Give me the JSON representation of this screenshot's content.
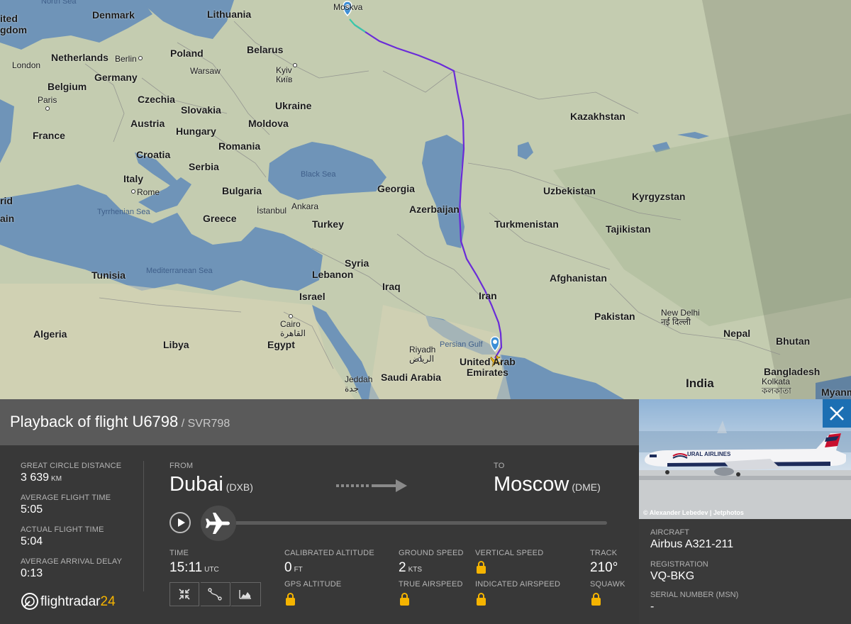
{
  "map": {
    "countries": [
      {
        "id": "c-united-kingdom",
        "label": "ited\ngdom"
      },
      {
        "id": "c-denmark",
        "label": "Denmark"
      },
      {
        "id": "c-lithuania",
        "label": "Lithuania"
      },
      {
        "id": "c-netherlands",
        "label": "Netherlands"
      },
      {
        "id": "c-poland",
        "label": "Poland"
      },
      {
        "id": "c-belarus",
        "label": "Belarus"
      },
      {
        "id": "c-germany",
        "label": "Germany"
      },
      {
        "id": "c-belgium",
        "label": "Belgium"
      },
      {
        "id": "c-czechia",
        "label": "Czechia"
      },
      {
        "id": "c-slovakia",
        "label": "Slovakia"
      },
      {
        "id": "c-ukraine",
        "label": "Ukraine"
      },
      {
        "id": "c-kazakhstan",
        "label": "Kazakhstan"
      },
      {
        "id": "c-austria",
        "label": "Austria"
      },
      {
        "id": "c-moldova",
        "label": "Moldova"
      },
      {
        "id": "c-hungary",
        "label": "Hungary"
      },
      {
        "id": "c-france",
        "label": "France"
      },
      {
        "id": "c-romania",
        "label": "Romania"
      },
      {
        "id": "c-croatia",
        "label": "Croatia"
      },
      {
        "id": "c-serbia",
        "label": "Serbia"
      },
      {
        "id": "c-italy",
        "label": "Italy"
      },
      {
        "id": "c-georgia",
        "label": "Georgia"
      },
      {
        "id": "c-uzbekistan",
        "label": "Uzbekistan"
      },
      {
        "id": "c-kyrgyzstan",
        "label": "Kyrgyzstan"
      },
      {
        "id": "c-bulgaria",
        "label": "Bulgaria"
      },
      {
        "id": "c-azerbaijan",
        "label": "Azerbaijan"
      },
      {
        "id": "c-greece",
        "label": "Greece"
      },
      {
        "id": "c-turkey",
        "label": "Turkey"
      },
      {
        "id": "c-turkmenistan",
        "label": "Turkmenistan"
      },
      {
        "id": "c-tajikistan",
        "label": "Tajikistan"
      },
      {
        "id": "c-syria",
        "label": "Syria"
      },
      {
        "id": "c-tunisia",
        "label": "Tunisia"
      },
      {
        "id": "c-lebanon",
        "label": "Lebanon"
      },
      {
        "id": "c-afghanistan",
        "label": "Afghanistan"
      },
      {
        "id": "c-iraq",
        "label": "Iraq"
      },
      {
        "id": "c-israel",
        "label": "Israel"
      },
      {
        "id": "c-iran",
        "label": "Iran"
      },
      {
        "id": "c-pakistan",
        "label": "Pakistan"
      },
      {
        "id": "c-algeria",
        "label": "Algeria"
      },
      {
        "id": "c-libya",
        "label": "Libya"
      },
      {
        "id": "c-egypt",
        "label": "Egypt"
      },
      {
        "id": "c-nepal",
        "label": "Nepal"
      },
      {
        "id": "c-bhutan",
        "label": "Bhutan"
      },
      {
        "id": "c-uae",
        "label": "United Arab\nEmirates"
      },
      {
        "id": "c-saudi-arabia",
        "label": "Saudi Arabia"
      },
      {
        "id": "c-bangladesh",
        "label": "Bangladesh"
      },
      {
        "id": "c-india",
        "label": "India"
      },
      {
        "id": "c-myanmar",
        "label": "Myanm"
      },
      {
        "id": "c-spain",
        "label": "ain"
      },
      {
        "id": "c-madrid",
        "label": "rid"
      }
    ],
    "cities": [
      {
        "id": "city-moscow",
        "label": "Moskva"
      },
      {
        "id": "city-berlin",
        "label": "Berlin"
      },
      {
        "id": "city-london",
        "label": "London"
      },
      {
        "id": "city-warsaw",
        "label": "Warsaw"
      },
      {
        "id": "city-kyiv",
        "label": "Kyiv\nКиїв"
      },
      {
        "id": "city-paris",
        "label": "Paris"
      },
      {
        "id": "city-rome",
        "label": "Rome"
      },
      {
        "id": "city-istanbul",
        "label": "İstanbul"
      },
      {
        "id": "city-ankara",
        "label": "Ankara"
      },
      {
        "id": "city-cairo",
        "label": "Cairo\nالقاهرة"
      },
      {
        "id": "city-riyadh",
        "label": "Riyadh\nالرياض"
      },
      {
        "id": "city-jeddah",
        "label": "Jeddah\nجدة"
      },
      {
        "id": "city-new-delhi",
        "label": "New Delhi\nनई दिल्ली"
      },
      {
        "id": "city-kolkata",
        "label": "Kolkata\nকলকাতা"
      }
    ],
    "seas": [
      {
        "id": "sea-north",
        "label": "North Sea"
      },
      {
        "id": "sea-black",
        "label": "Black Sea"
      },
      {
        "id": "sea-tyrrhenian",
        "label": "Tyrrhenian Sea"
      },
      {
        "id": "sea-mediterranean",
        "label": "Mediterranean Sea"
      },
      {
        "id": "sea-persian-gulf",
        "label": "Persian Gulf"
      }
    ],
    "route_color_main": "#6a2bd8",
    "route_color_end": "#39c9a8"
  },
  "flight": {
    "title_prefix": "Playback of flight",
    "flight_number": "U6798",
    "callsign_sep": " / ",
    "callsign": "SVR798"
  },
  "stats": {
    "gcd_label": "GREAT CIRCLE DISTANCE",
    "gcd_value": "3 639",
    "gcd_unit": "KM",
    "avg_time_label": "AVERAGE FLIGHT TIME",
    "avg_time_value": "5:05",
    "actual_time_label": "ACTUAL FLIGHT TIME",
    "actual_time_value": "5:04",
    "delay_label": "AVERAGE ARRIVAL DELAY",
    "delay_value": "0:13"
  },
  "route": {
    "from_label": "FROM",
    "from_city": "Dubai",
    "from_code": "(DXB)",
    "to_label": "TO",
    "to_city": "Moscow",
    "to_code": "(DME)"
  },
  "playback": {
    "progress": 0.0
  },
  "telemetry": {
    "time_label": "TIME",
    "time_value": "15:11",
    "time_unit": "UTC",
    "cal_alt_label": "CALIBRATED ALTITUDE",
    "cal_alt_value": "0",
    "cal_alt_unit": "FT",
    "gps_alt_label": "GPS ALTITUDE",
    "ground_speed_label": "GROUND SPEED",
    "ground_speed_value": "2",
    "ground_speed_unit": "KTS",
    "true_airspeed_label": "TRUE AIRSPEED",
    "vertical_speed_label": "VERTICAL SPEED",
    "indicated_airspeed_label": "INDICATED AIRSPEED",
    "track_label": "TRACK",
    "track_value": "210°",
    "squawk_label": "SQUAWK"
  },
  "brand": {
    "name_a": "flightradar",
    "name_b": "24",
    "accent": "#f5b400"
  },
  "aircraft": {
    "photo_credit": "© Alexander Lebedev | Jetphotos",
    "livery_text": "URAL AIRLINES",
    "aircraft_label": "AIRCRAFT",
    "aircraft_value": "Airbus A321-211",
    "registration_label": "REGISTRATION",
    "registration_value": "VQ-BKG",
    "msn_label": "SERIAL NUMBER (MSN)",
    "msn_value": "-"
  },
  "colors": {
    "titlebar": "#5a5a5a",
    "panel": "#383838",
    "close_button": "#1c6fb3",
    "lock": "#f5b400"
  }
}
